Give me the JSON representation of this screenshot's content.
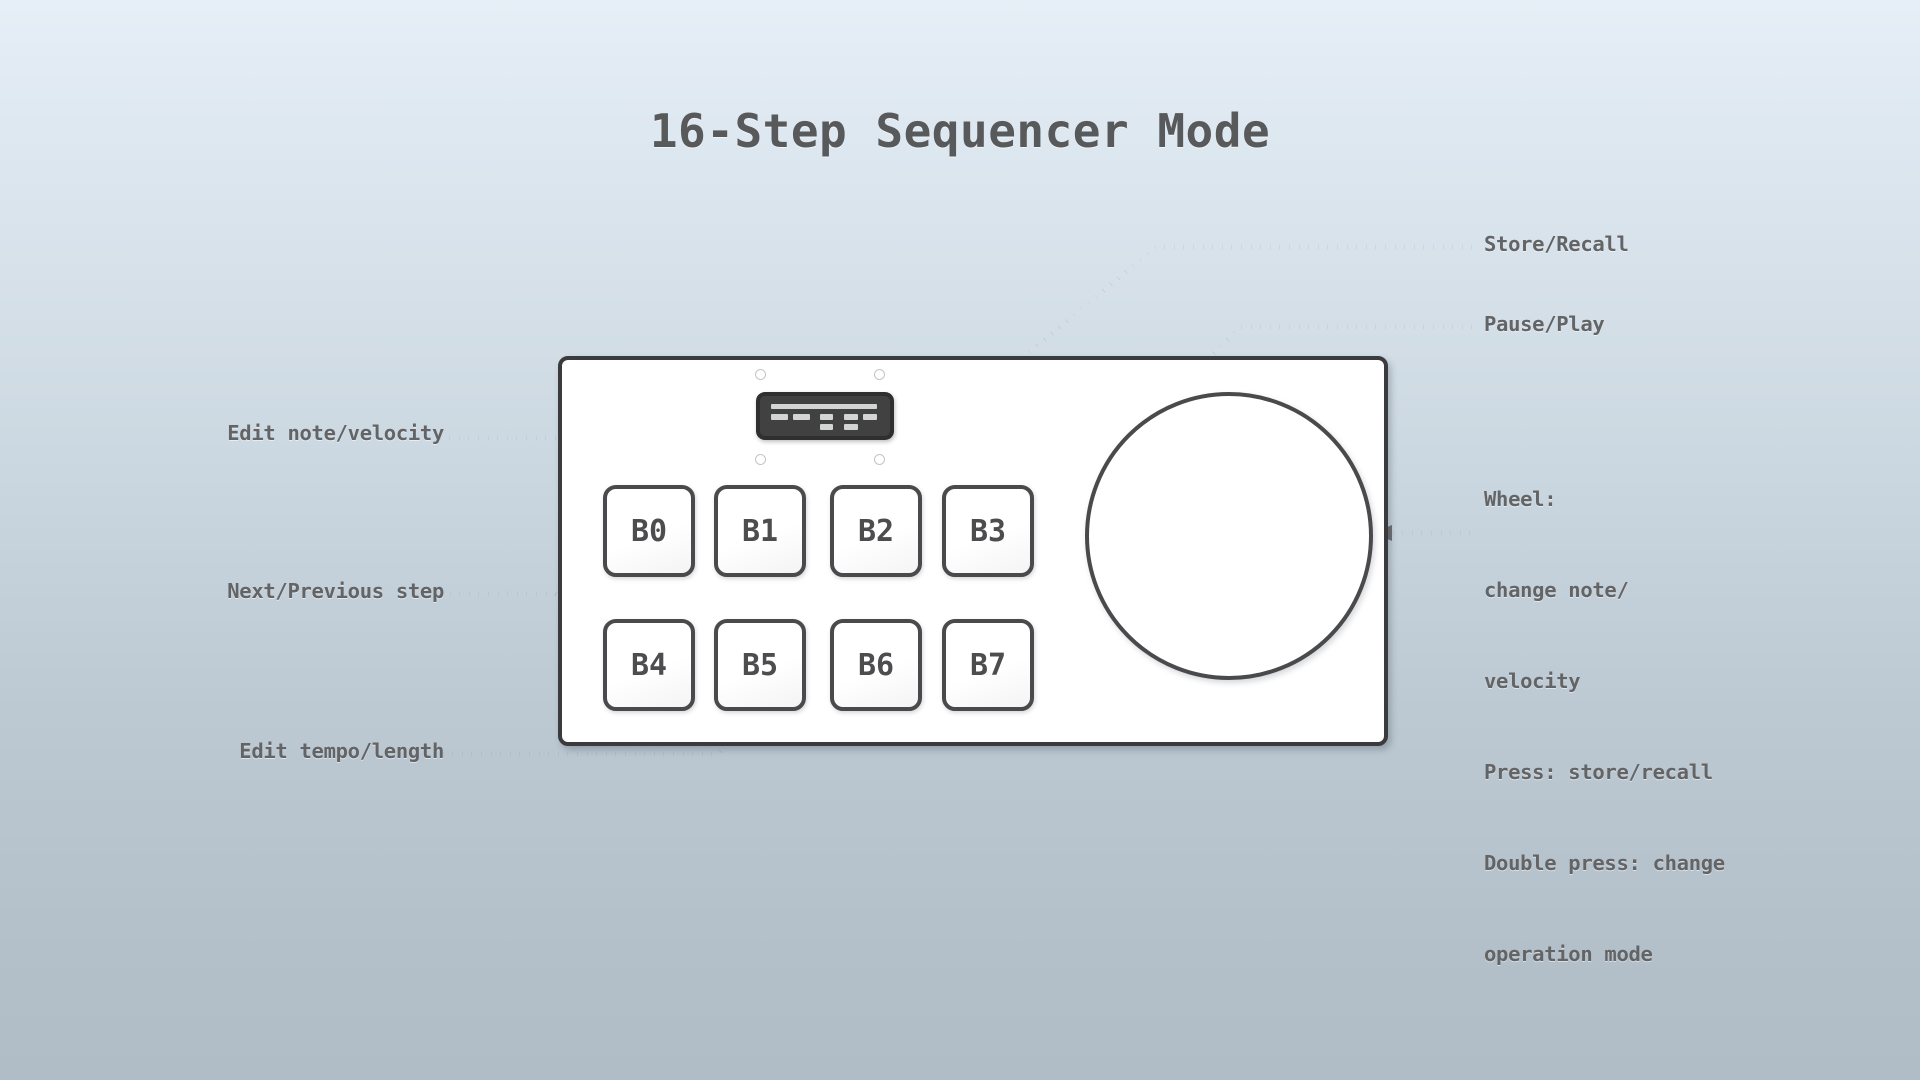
{
  "page": {
    "title": "16-Step Sequencer Mode",
    "background_top": "#e6eef6",
    "background_bottom": "#b0bcc6",
    "ink": "#636466",
    "title_color": "#58595b"
  },
  "device": {
    "name": "sequencer-panel",
    "body_color": "#ffffff",
    "stroke_color": "#3b3b3d",
    "display": {
      "name": "lcd-display",
      "background": "#414142",
      "segment_color": "#d3d4d4",
      "segment_count": 8
    },
    "screws": [
      "top-left",
      "top-right",
      "bottom-left",
      "bottom-right"
    ],
    "pads": [
      {
        "label": "B0"
      },
      {
        "label": "B1"
      },
      {
        "label": "B2"
      },
      {
        "label": "B3"
      },
      {
        "label": "B4"
      },
      {
        "label": "B5"
      },
      {
        "label": "B6"
      },
      {
        "label": "B7"
      }
    ],
    "wheel": {
      "name": "jog-wheel",
      "fill": "#ffffff",
      "stroke": "#4a4a4c"
    }
  },
  "annotations": {
    "left": [
      {
        "id": "edit-note-velocity",
        "text": "Edit note/velocity"
      },
      {
        "id": "next-previous-step",
        "text": "Next/Previous step"
      },
      {
        "id": "edit-tempo-length",
        "text": "Edit tempo/length"
      }
    ],
    "right": [
      {
        "id": "store-recall",
        "text": "Store/Recall"
      },
      {
        "id": "pause-play",
        "text": "Pause/Play"
      },
      {
        "id": "wheel-functions",
        "lines": [
          "Wheel:",
          "change note/",
          "velocity",
          "Press: store/recall",
          "Double press: change",
          "operation mode"
        ]
      }
    ]
  },
  "wheel_text": {
    "line1": "Wheel:",
    "line2": "change note/",
    "line3": "velocity",
    "line4": "Press: store/recall",
    "line5": "Double press: change",
    "line6": "operation mode"
  }
}
